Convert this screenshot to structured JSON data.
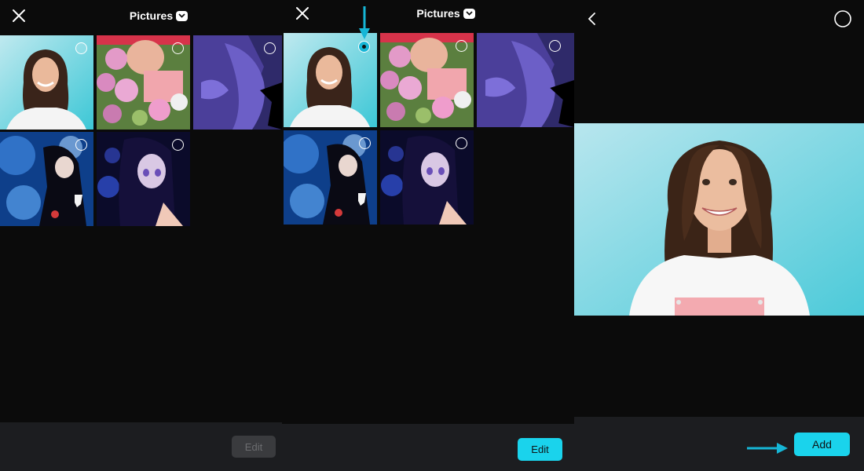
{
  "panel1": {
    "title": "Pictures",
    "edit_label": "Edit"
  },
  "panel2": {
    "title": "Pictures",
    "edit_label": "Edit"
  },
  "panel3": {
    "add_label": "Add"
  },
  "icons": {
    "close": "close-icon",
    "dropdown": "chevron-down-icon",
    "back": "chevron-left-icon",
    "select": "circle-outline-icon"
  },
  "colors": {
    "background": "#0b0b0b",
    "footer": "#1c1d20",
    "accent": "#1ad3ec",
    "disabled_button": "#3a3b3e",
    "disabled_text": "#6c6d70"
  }
}
